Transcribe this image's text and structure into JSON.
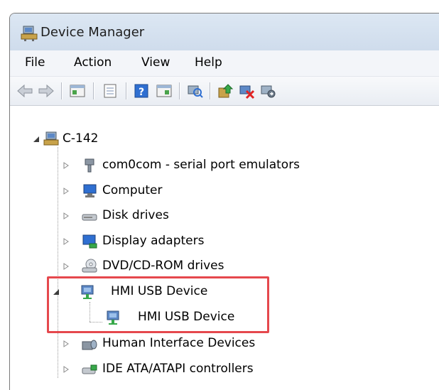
{
  "window": {
    "title": "Device Manager"
  },
  "menu": [
    "File",
    "Action",
    "View",
    "Help"
  ],
  "toolbar": {
    "buttons": [
      "back-icon",
      "forward-icon",
      "show-hide-console-tree-icon",
      "properties-icon",
      "help-icon",
      "show-action-pane-icon",
      "scan-hardware-icon",
      "update-driver-icon",
      "uninstall-icon",
      "disable-icon"
    ]
  },
  "tree": {
    "root": "C-142",
    "items": [
      {
        "label": "com0com - serial port emulators",
        "icon": "port-icon"
      },
      {
        "label": "Computer",
        "icon": "computer-icon"
      },
      {
        "label": "Disk drives",
        "icon": "disk-drive-icon"
      },
      {
        "label": "Display adapters",
        "icon": "display-adapter-icon"
      },
      {
        "label": "DVD/CD-ROM drives",
        "icon": "dvd-drive-icon"
      },
      {
        "label": "HMI USB Device",
        "icon": "usb-device-icon"
      },
      {
        "label": "HMI USB Device",
        "icon": "usb-device-icon"
      },
      {
        "label": "Human Interface Devices",
        "icon": "hid-icon"
      },
      {
        "label": "IDE ATA/ATAPI controllers",
        "icon": "ide-controller-icon"
      }
    ]
  },
  "colors": {
    "highlight": "#e5484d",
    "titlebar": "#dce7f3"
  }
}
